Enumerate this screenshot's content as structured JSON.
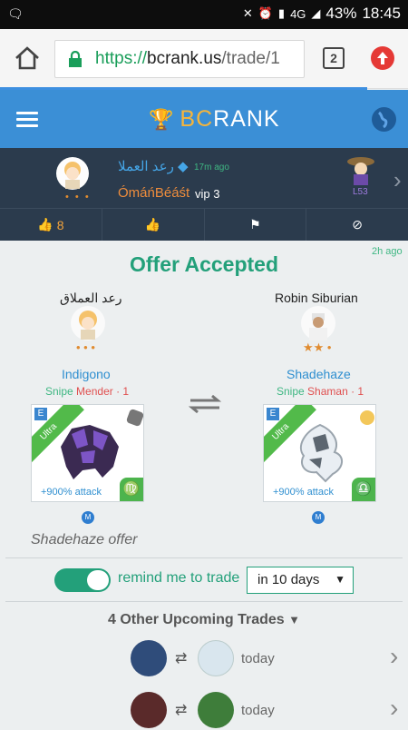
{
  "status_bar": {
    "battery": "43%",
    "time": "18:45",
    "network": "4G"
  },
  "browser": {
    "url_scheme": "https://",
    "url_host": "bcrank.us",
    "url_path": "/trade/1",
    "tab_count": "2"
  },
  "app": {
    "brand_a": "BC",
    "brand_b": "RANK"
  },
  "user_strip": {
    "name1": "رعد العملا",
    "time": "17m ago",
    "name2": "ÓmáńBéáśt",
    "vip": "vip 3",
    "level": "L53"
  },
  "actions": {
    "like_count": "8"
  },
  "trade": {
    "time": "2h ago",
    "title": "Offer Accepted",
    "left": {
      "player": "رعد العملاق",
      "stars": "• • •",
      "monster": "Indigono",
      "type": "Snipe",
      "role": "Mender · 1",
      "tier": "Ultra",
      "bonus": "+900% attack",
      "badge": "M",
      "zodiac": "♍"
    },
    "right": {
      "player": "Robin Siburian",
      "stars": "★★ •",
      "monster": "Shadehaze",
      "type": "Snipe",
      "role": "Shaman · 1",
      "tier": "Ultra",
      "bonus": "+900% attack",
      "badge": "M",
      "zodiac": "♎"
    },
    "offer_label": "Shadehaze offer"
  },
  "reminder": {
    "label": "remind me to trade",
    "option": "in 10 days",
    "enabled": true
  },
  "upcoming": {
    "heading": "4 Other Upcoming Trades",
    "rows": [
      {
        "when": "today"
      },
      {
        "when": "today"
      }
    ]
  },
  "colors": {
    "accent": "#23a07a",
    "header": "#3b8fd6",
    "strip": "#2b3b4d"
  }
}
